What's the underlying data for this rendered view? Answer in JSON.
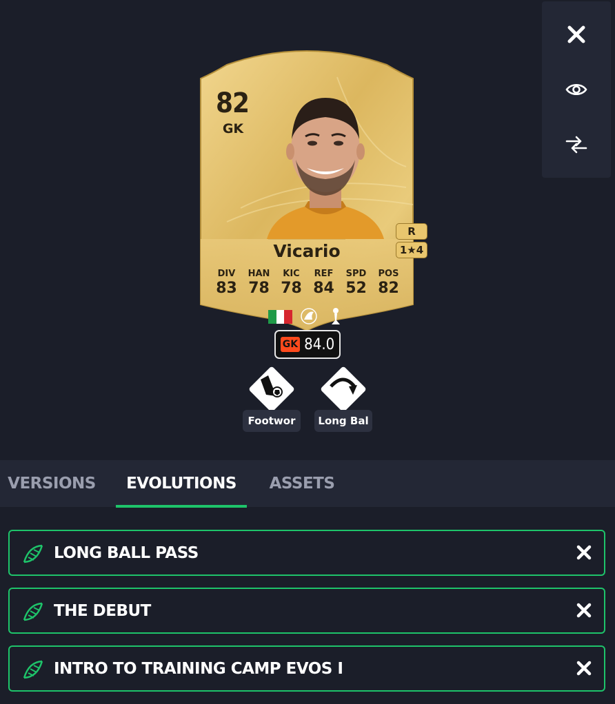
{
  "card": {
    "rating": "82",
    "position": "GK",
    "name": "Vicario",
    "preferred_foot": "R",
    "skill_weak": "1★",
    "skill_moves": "4",
    "stats": [
      {
        "label": "DIV",
        "value": "83"
      },
      {
        "label": "HAN",
        "value": "78"
      },
      {
        "label": "KIC",
        "value": "78"
      },
      {
        "label": "REF",
        "value": "84"
      },
      {
        "label": "SPD",
        "value": "52"
      },
      {
        "label": "POS",
        "value": "82"
      }
    ],
    "nation_icon": "italy-flag-icon",
    "league_icon": "premier-league-icon",
    "club_icon": "tottenham-icon"
  },
  "rating_pill": {
    "position": "GK",
    "value": "84.0"
  },
  "playstyles": [
    {
      "label": "Footwor",
      "icon": "footwork-icon"
    },
    {
      "label": "Long Bal",
      "icon": "long-ball-icon"
    }
  ],
  "side_actions": [
    {
      "icon": "close-icon"
    },
    {
      "icon": "eye-icon"
    },
    {
      "icon": "compare-arrows-icon"
    }
  ],
  "tabs": [
    {
      "label": "VERSIONS",
      "active": false
    },
    {
      "label": "EVOLUTIONS",
      "active": true
    },
    {
      "label": "ASSETS",
      "active": false
    }
  ],
  "evolutions": [
    {
      "title": "LONG BALL PASS"
    },
    {
      "title": "THE DEBUT"
    },
    {
      "title": "INTRO TO TRAINING CAMP EVOS I"
    }
  ],
  "colors": {
    "background": "#1b1e29",
    "accent_green": "#1ec46a",
    "card_gold": "#e2c06a",
    "card_text": "#2b2213"
  }
}
